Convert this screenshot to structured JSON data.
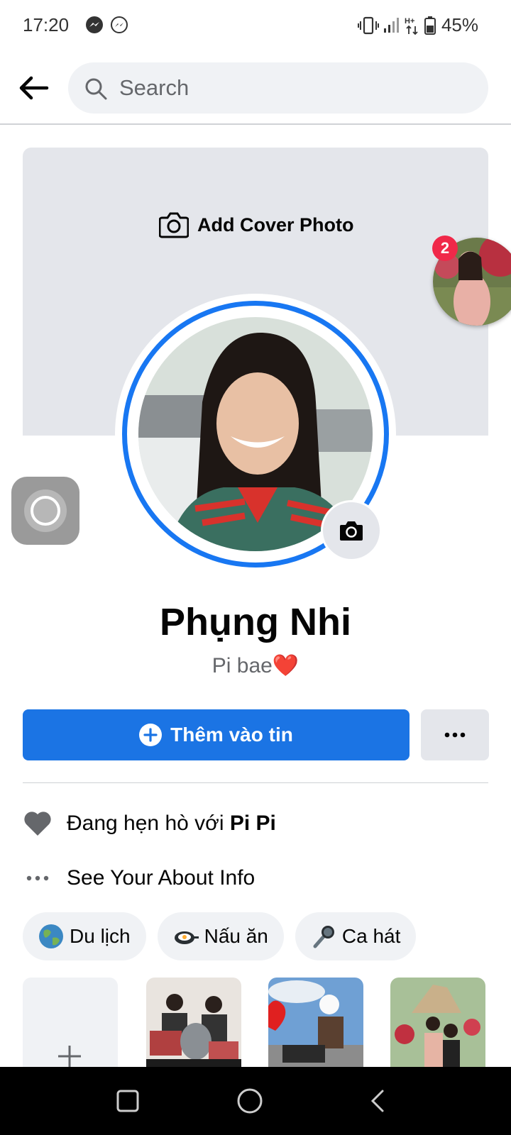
{
  "status_bar": {
    "time": "17:20",
    "battery": "45%",
    "network": "H+",
    "icons": [
      "messenger-icon",
      "messenger-icon",
      "vibrate-icon",
      "signal-icon",
      "data-icon",
      "battery-icon"
    ]
  },
  "header": {
    "search_placeholder": "Search"
  },
  "cover": {
    "add_cover_label": "Add Cover Photo"
  },
  "chat_bubble": {
    "badge_count": "2"
  },
  "profile": {
    "name": "Phụng Nhi",
    "bio": "Pi bae",
    "bio_emoji": "❤️"
  },
  "actions": {
    "add_story_label": "Thêm vào tin",
    "more_label": "•••"
  },
  "details": {
    "relationship_prefix": "Đang hẹn hò với ",
    "relationship_name": "Pi Pi",
    "about_label": "See Your About Info"
  },
  "hobbies": [
    {
      "label": "Du lịch",
      "icon": "globe-icon"
    },
    {
      "label": "Nấu ăn",
      "icon": "frying-pan-icon"
    },
    {
      "label": "Ca hát",
      "icon": "microphone-icon"
    }
  ],
  "colors": {
    "accent": "#1b74e4",
    "ring": "#1877f2",
    "badge": "#f02849",
    "secondary_bg": "#e4e6eb"
  }
}
